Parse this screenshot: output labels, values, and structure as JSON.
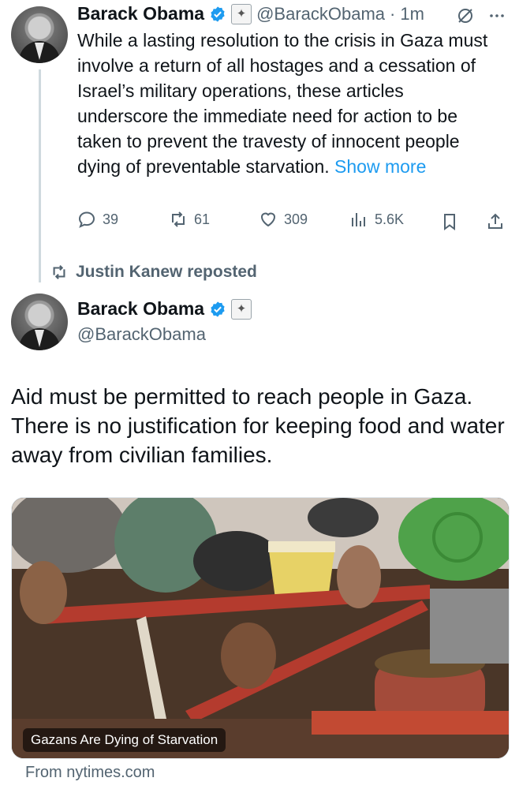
{
  "quoted_tweet": {
    "author_name": "Barack Obama",
    "handle": "@BarackObama",
    "separator": "·",
    "time": "1m",
    "text": "While a lasting resolution to the crisis in Gaza must involve a return of all hostages and a cessation of Israel’s military operations, these articles underscore the immediate need for action to be taken to prevent the travesty of innocent people dying of preventable starvation.",
    "show_more": "Show more",
    "replies": "39",
    "reposts": "61",
    "likes": "309",
    "views": "5.6K"
  },
  "repost_banner": {
    "label": "Justin Kanew reposted"
  },
  "main_tweet": {
    "author_name": "Barack Obama",
    "handle": "@BarackObama",
    "text": "Aid must be permitted to reach people in Gaza. There is no justification for keeping food and water away from civilian families.",
    "media_caption": "Gazans Are Dying of Starvation",
    "source": "From nytimes.com"
  },
  "colors": {
    "accent": "#1d9bf0",
    "secondary_text": "#536471"
  }
}
